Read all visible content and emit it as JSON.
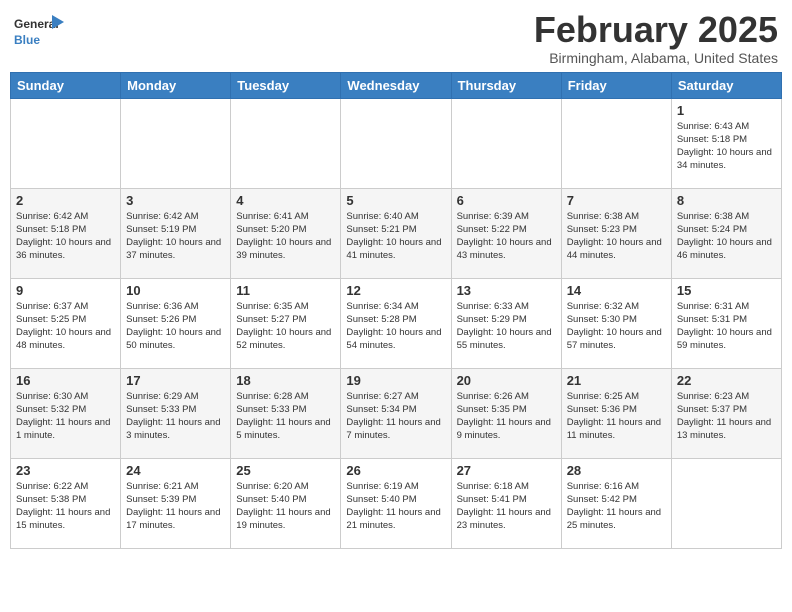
{
  "header": {
    "logo": {
      "text_general": "General",
      "text_blue": "Blue"
    },
    "title": "February 2025",
    "location": "Birmingham, Alabama, United States"
  },
  "weekdays": [
    "Sunday",
    "Monday",
    "Tuesday",
    "Wednesday",
    "Thursday",
    "Friday",
    "Saturday"
  ],
  "weeks": [
    [
      {
        "day": "",
        "info": ""
      },
      {
        "day": "",
        "info": ""
      },
      {
        "day": "",
        "info": ""
      },
      {
        "day": "",
        "info": ""
      },
      {
        "day": "",
        "info": ""
      },
      {
        "day": "",
        "info": ""
      },
      {
        "day": "1",
        "info": "Sunrise: 6:43 AM\nSunset: 5:18 PM\nDaylight: 10 hours and 34 minutes."
      }
    ],
    [
      {
        "day": "2",
        "info": "Sunrise: 6:42 AM\nSunset: 5:18 PM\nDaylight: 10 hours and 36 minutes."
      },
      {
        "day": "3",
        "info": "Sunrise: 6:42 AM\nSunset: 5:19 PM\nDaylight: 10 hours and 37 minutes."
      },
      {
        "day": "4",
        "info": "Sunrise: 6:41 AM\nSunset: 5:20 PM\nDaylight: 10 hours and 39 minutes."
      },
      {
        "day": "5",
        "info": "Sunrise: 6:40 AM\nSunset: 5:21 PM\nDaylight: 10 hours and 41 minutes."
      },
      {
        "day": "6",
        "info": "Sunrise: 6:39 AM\nSunset: 5:22 PM\nDaylight: 10 hours and 43 minutes."
      },
      {
        "day": "7",
        "info": "Sunrise: 6:38 AM\nSunset: 5:23 PM\nDaylight: 10 hours and 44 minutes."
      },
      {
        "day": "8",
        "info": "Sunrise: 6:38 AM\nSunset: 5:24 PM\nDaylight: 10 hours and 46 minutes."
      }
    ],
    [
      {
        "day": "9",
        "info": "Sunrise: 6:37 AM\nSunset: 5:25 PM\nDaylight: 10 hours and 48 minutes."
      },
      {
        "day": "10",
        "info": "Sunrise: 6:36 AM\nSunset: 5:26 PM\nDaylight: 10 hours and 50 minutes."
      },
      {
        "day": "11",
        "info": "Sunrise: 6:35 AM\nSunset: 5:27 PM\nDaylight: 10 hours and 52 minutes."
      },
      {
        "day": "12",
        "info": "Sunrise: 6:34 AM\nSunset: 5:28 PM\nDaylight: 10 hours and 54 minutes."
      },
      {
        "day": "13",
        "info": "Sunrise: 6:33 AM\nSunset: 5:29 PM\nDaylight: 10 hours and 55 minutes."
      },
      {
        "day": "14",
        "info": "Sunrise: 6:32 AM\nSunset: 5:30 PM\nDaylight: 10 hours and 57 minutes."
      },
      {
        "day": "15",
        "info": "Sunrise: 6:31 AM\nSunset: 5:31 PM\nDaylight: 10 hours and 59 minutes."
      }
    ],
    [
      {
        "day": "16",
        "info": "Sunrise: 6:30 AM\nSunset: 5:32 PM\nDaylight: 11 hours and 1 minute."
      },
      {
        "day": "17",
        "info": "Sunrise: 6:29 AM\nSunset: 5:33 PM\nDaylight: 11 hours and 3 minutes."
      },
      {
        "day": "18",
        "info": "Sunrise: 6:28 AM\nSunset: 5:33 PM\nDaylight: 11 hours and 5 minutes."
      },
      {
        "day": "19",
        "info": "Sunrise: 6:27 AM\nSunset: 5:34 PM\nDaylight: 11 hours and 7 minutes."
      },
      {
        "day": "20",
        "info": "Sunrise: 6:26 AM\nSunset: 5:35 PM\nDaylight: 11 hours and 9 minutes."
      },
      {
        "day": "21",
        "info": "Sunrise: 6:25 AM\nSunset: 5:36 PM\nDaylight: 11 hours and 11 minutes."
      },
      {
        "day": "22",
        "info": "Sunrise: 6:23 AM\nSunset: 5:37 PM\nDaylight: 11 hours and 13 minutes."
      }
    ],
    [
      {
        "day": "23",
        "info": "Sunrise: 6:22 AM\nSunset: 5:38 PM\nDaylight: 11 hours and 15 minutes."
      },
      {
        "day": "24",
        "info": "Sunrise: 6:21 AM\nSunset: 5:39 PM\nDaylight: 11 hours and 17 minutes."
      },
      {
        "day": "25",
        "info": "Sunrise: 6:20 AM\nSunset: 5:40 PM\nDaylight: 11 hours and 19 minutes."
      },
      {
        "day": "26",
        "info": "Sunrise: 6:19 AM\nSunset: 5:40 PM\nDaylight: 11 hours and 21 minutes."
      },
      {
        "day": "27",
        "info": "Sunrise: 6:18 AM\nSunset: 5:41 PM\nDaylight: 11 hours and 23 minutes."
      },
      {
        "day": "28",
        "info": "Sunrise: 6:16 AM\nSunset: 5:42 PM\nDaylight: 11 hours and 25 minutes."
      },
      {
        "day": "",
        "info": ""
      }
    ]
  ]
}
